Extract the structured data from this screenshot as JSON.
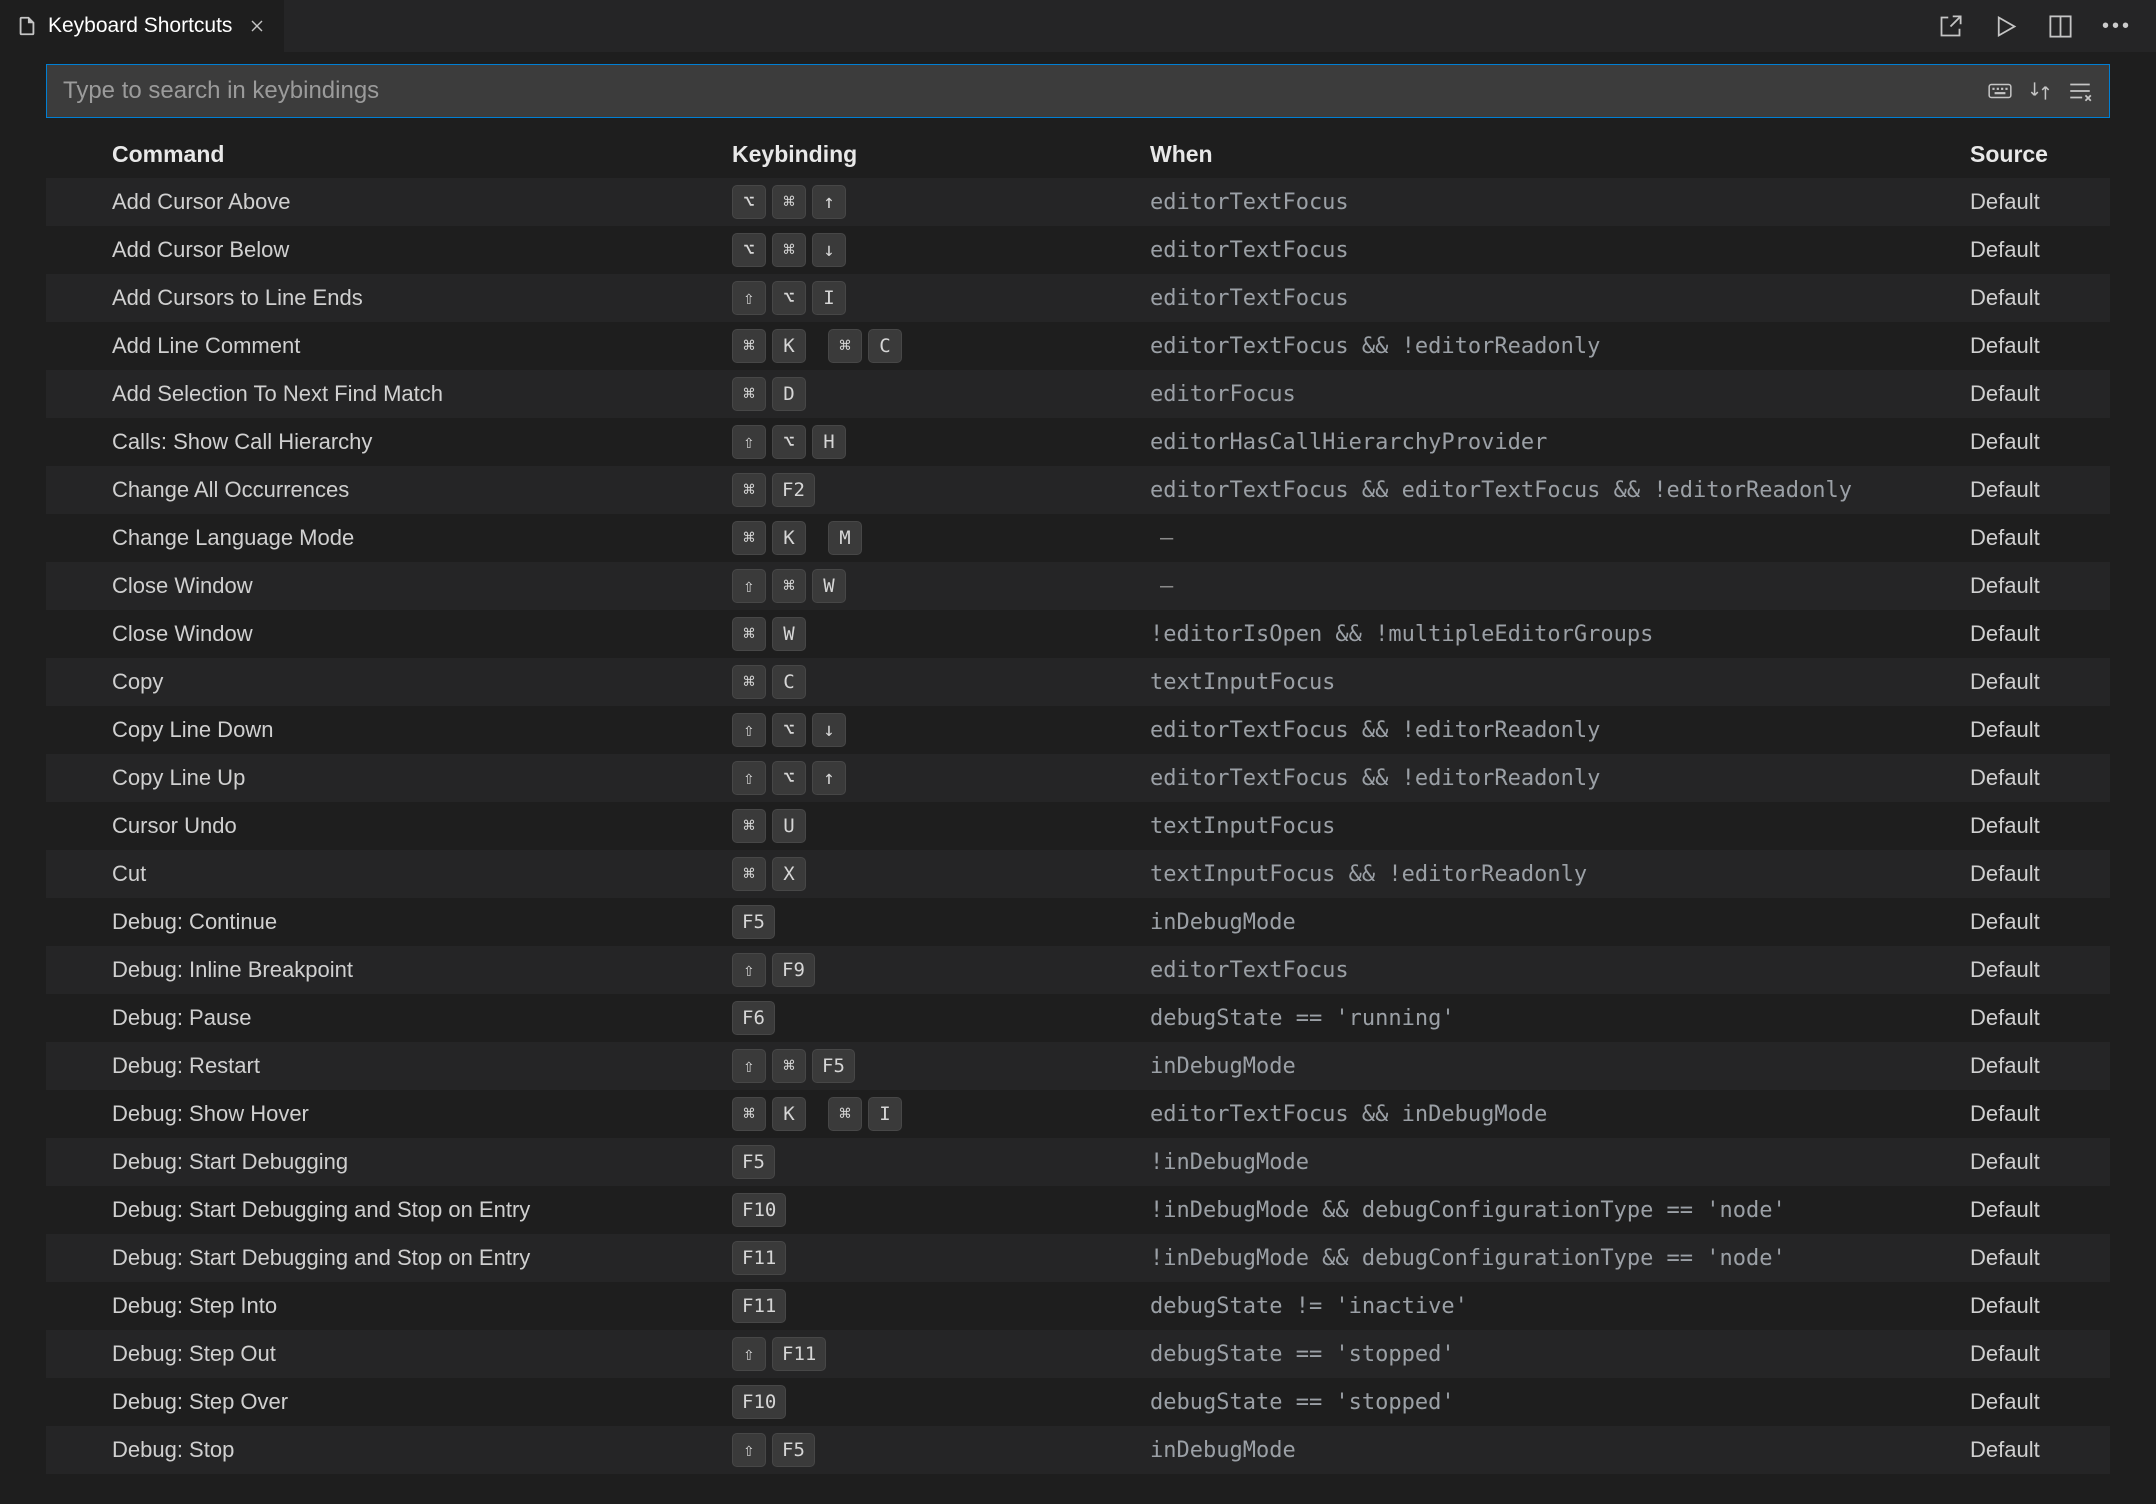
{
  "tab": {
    "title": "Keyboard Shortcuts"
  },
  "search": {
    "placeholder": "Type to search in keybindings"
  },
  "columns": {
    "command": "Command",
    "keybinding": "Keybinding",
    "when": "When",
    "source": "Source"
  },
  "rows": [
    {
      "command": "Add Cursor Above",
      "keys": [
        [
          "⌥",
          "⌘",
          "↑"
        ]
      ],
      "when": "editorTextFocus",
      "source": "Default"
    },
    {
      "command": "Add Cursor Below",
      "keys": [
        [
          "⌥",
          "⌘",
          "↓"
        ]
      ],
      "when": "editorTextFocus",
      "source": "Default"
    },
    {
      "command": "Add Cursors to Line Ends",
      "keys": [
        [
          "⇧",
          "⌥",
          "I"
        ]
      ],
      "when": "editorTextFocus",
      "source": "Default"
    },
    {
      "command": "Add Line Comment",
      "keys": [
        [
          "⌘",
          "K"
        ],
        [
          "⌘",
          "C"
        ]
      ],
      "when": "editorTextFocus && !editorReadonly",
      "source": "Default"
    },
    {
      "command": "Add Selection To Next Find Match",
      "keys": [
        [
          "⌘",
          "D"
        ]
      ],
      "when": "editorFocus",
      "source": "Default"
    },
    {
      "command": "Calls: Show Call Hierarchy",
      "keys": [
        [
          "⇧",
          "⌥",
          "H"
        ]
      ],
      "when": "editorHasCallHierarchyProvider",
      "source": "Default"
    },
    {
      "command": "Change All Occurrences",
      "keys": [
        [
          "⌘",
          "F2"
        ]
      ],
      "when": "editorTextFocus && editorTextFocus && !editorReadonly",
      "source": "Default"
    },
    {
      "command": "Change Language Mode",
      "keys": [
        [
          "⌘",
          "K"
        ],
        [
          "M"
        ]
      ],
      "when": "—",
      "source": "Default"
    },
    {
      "command": "Close Window",
      "keys": [
        [
          "⇧",
          "⌘",
          "W"
        ]
      ],
      "when": "—",
      "source": "Default"
    },
    {
      "command": "Close Window",
      "keys": [
        [
          "⌘",
          "W"
        ]
      ],
      "when": "!editorIsOpen && !multipleEditorGroups",
      "source": "Default"
    },
    {
      "command": "Copy",
      "keys": [
        [
          "⌘",
          "C"
        ]
      ],
      "when": "textInputFocus",
      "source": "Default"
    },
    {
      "command": "Copy Line Down",
      "keys": [
        [
          "⇧",
          "⌥",
          "↓"
        ]
      ],
      "when": "editorTextFocus && !editorReadonly",
      "source": "Default"
    },
    {
      "command": "Copy Line Up",
      "keys": [
        [
          "⇧",
          "⌥",
          "↑"
        ]
      ],
      "when": "editorTextFocus && !editorReadonly",
      "source": "Default"
    },
    {
      "command": "Cursor Undo",
      "keys": [
        [
          "⌘",
          "U"
        ]
      ],
      "when": "textInputFocus",
      "source": "Default"
    },
    {
      "command": "Cut",
      "keys": [
        [
          "⌘",
          "X"
        ]
      ],
      "when": "textInputFocus && !editorReadonly",
      "source": "Default"
    },
    {
      "command": "Debug: Continue",
      "keys": [
        [
          "F5"
        ]
      ],
      "when": "inDebugMode",
      "source": "Default"
    },
    {
      "command": "Debug: Inline Breakpoint",
      "keys": [
        [
          "⇧",
          "F9"
        ]
      ],
      "when": "editorTextFocus",
      "source": "Default"
    },
    {
      "command": "Debug: Pause",
      "keys": [
        [
          "F6"
        ]
      ],
      "when": "debugState == 'running'",
      "source": "Default"
    },
    {
      "command": "Debug: Restart",
      "keys": [
        [
          "⇧",
          "⌘",
          "F5"
        ]
      ],
      "when": "inDebugMode",
      "source": "Default"
    },
    {
      "command": "Debug: Show Hover",
      "keys": [
        [
          "⌘",
          "K"
        ],
        [
          "⌘",
          "I"
        ]
      ],
      "when": "editorTextFocus && inDebugMode",
      "source": "Default"
    },
    {
      "command": "Debug: Start Debugging",
      "keys": [
        [
          "F5"
        ]
      ],
      "when": "!inDebugMode",
      "source": "Default"
    },
    {
      "command": "Debug: Start Debugging and Stop on Entry",
      "keys": [
        [
          "F10"
        ]
      ],
      "when": "!inDebugMode && debugConfigurationType == 'node'",
      "source": "Default"
    },
    {
      "command": "Debug: Start Debugging and Stop on Entry",
      "keys": [
        [
          "F11"
        ]
      ],
      "when": "!inDebugMode && debugConfigurationType == 'node'",
      "source": "Default"
    },
    {
      "command": "Debug: Step Into",
      "keys": [
        [
          "F11"
        ]
      ],
      "when": "debugState != 'inactive'",
      "source": "Default"
    },
    {
      "command": "Debug: Step Out",
      "keys": [
        [
          "⇧",
          "F11"
        ]
      ],
      "when": "debugState == 'stopped'",
      "source": "Default"
    },
    {
      "command": "Debug: Step Over",
      "keys": [
        [
          "F10"
        ]
      ],
      "when": "debugState == 'stopped'",
      "source": "Default"
    },
    {
      "command": "Debug: Stop",
      "keys": [
        [
          "⇧",
          "F5"
        ]
      ],
      "when": "inDebugMode",
      "source": "Default"
    }
  ]
}
